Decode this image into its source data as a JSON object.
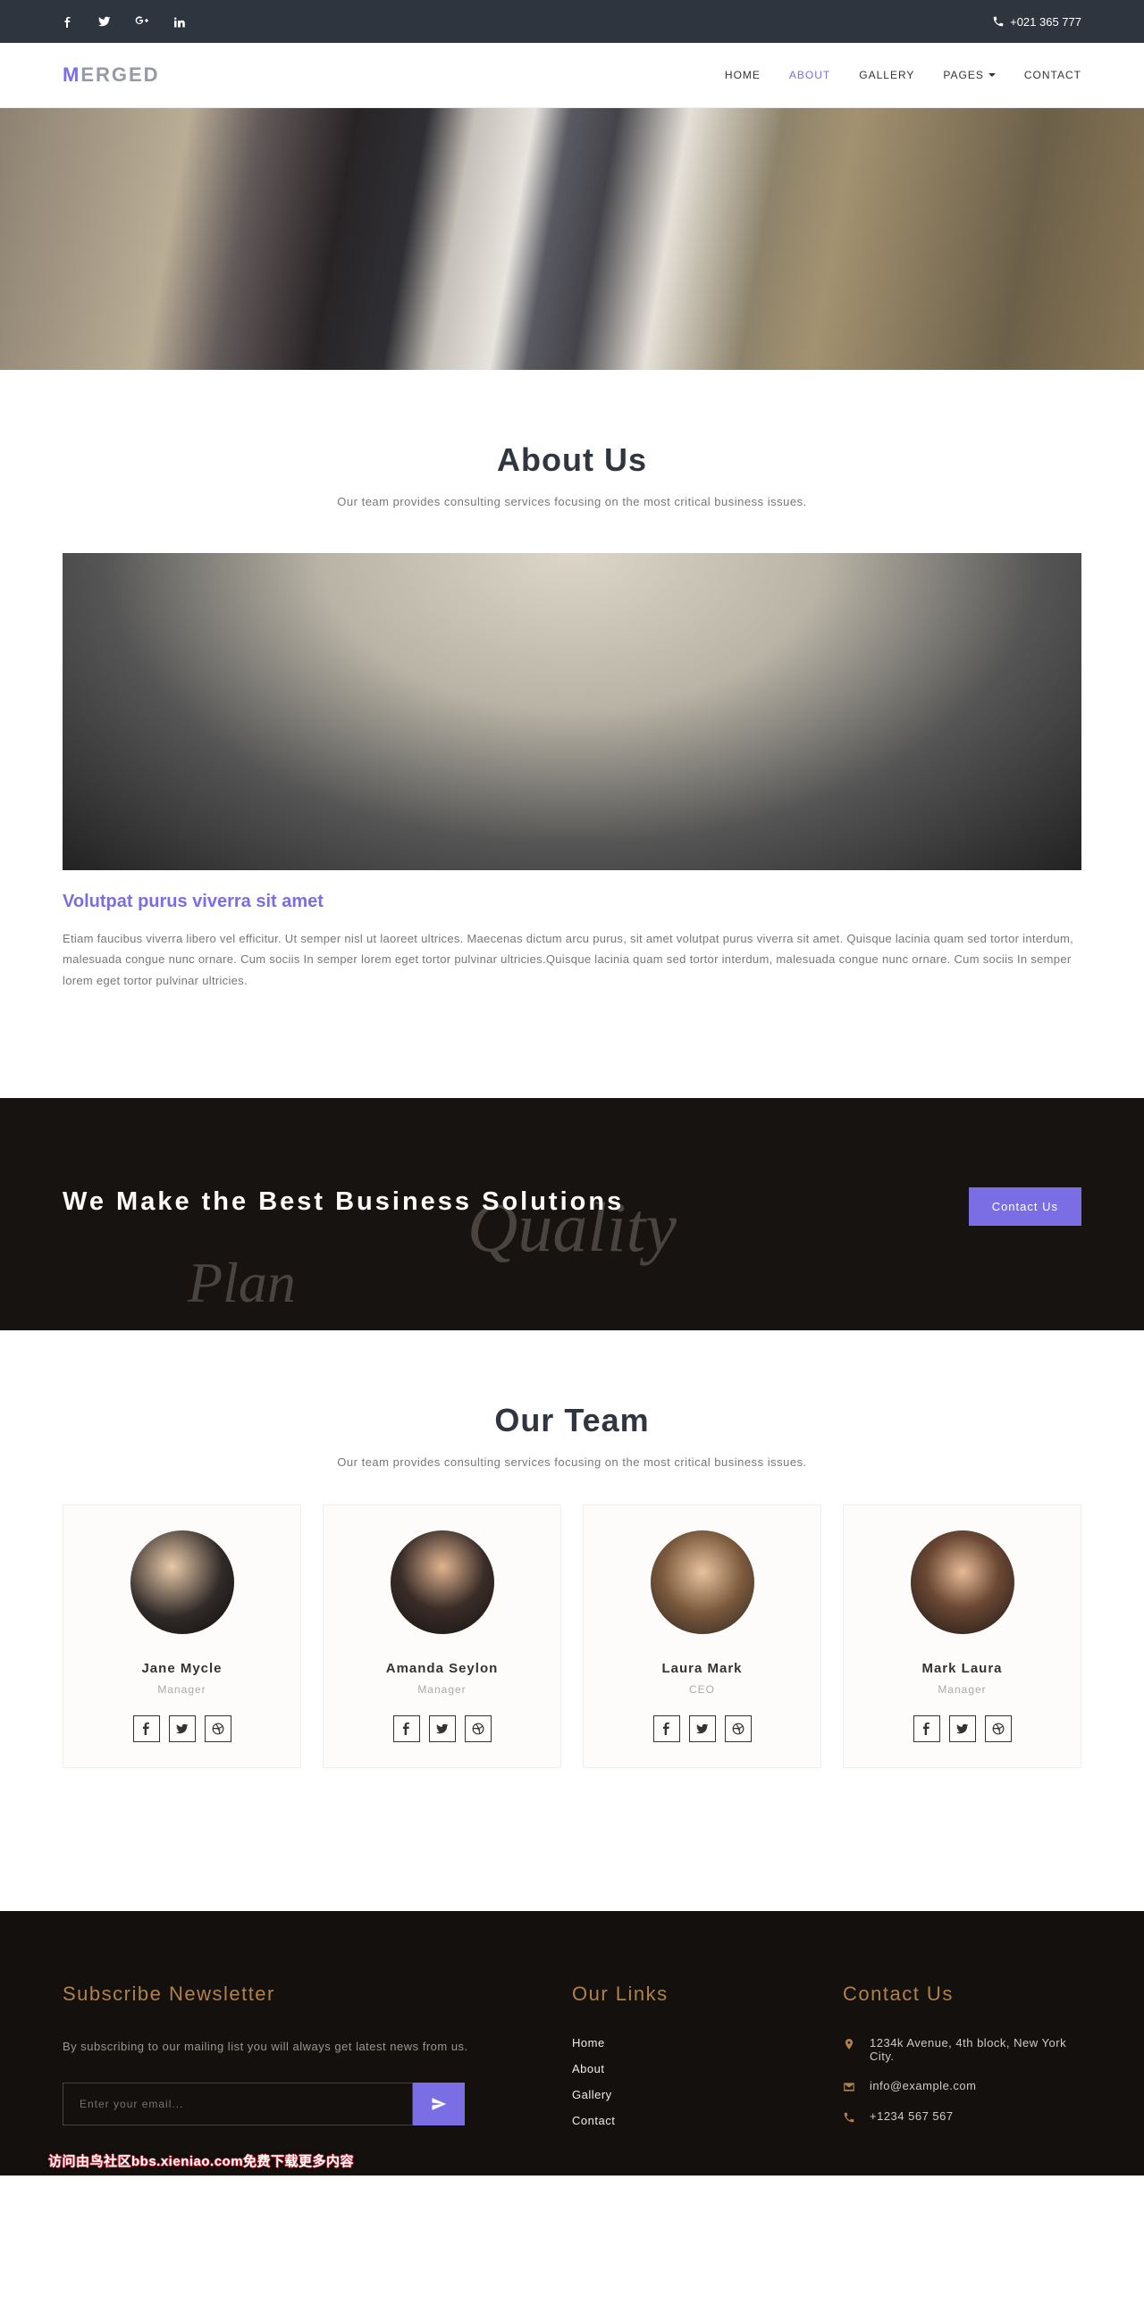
{
  "topbar": {
    "phone": "+021 365 777"
  },
  "logo": {
    "m": "M",
    "rest": "ERGED"
  },
  "nav": [
    "HOME",
    "ABOUT",
    "GALLERY",
    "PAGES",
    "CONTACT"
  ],
  "about": {
    "title": "About Us",
    "sub": "Our team provides consulting services focusing on the most critical business issues.",
    "headline": "Volutpat purus viverra sit amet",
    "body": "Etiam faucibus viverra libero vel efficitur. Ut semper nisl ut laoreet ultrices. Maecenas dictum arcu purus, sit amet volutpat purus viverra sit amet. Quisque lacinia quam sed tortor interdum, malesuada congue nunc ornare. Cum sociis In semper lorem eget tortor pulvinar ultricies.Quisque lacinia quam sed tortor interdum, malesuada congue nunc ornare. Cum sociis In semper lorem eget tortor pulvinar ultricies."
  },
  "quality": {
    "title": "We Make the Best Business Solutions",
    "btn": "Contact Us"
  },
  "team": {
    "title": "Our Team",
    "sub": "Our team provides consulting services focusing on the most critical business issues.",
    "members": [
      {
        "name": "Jane Mycle",
        "role": "Manager"
      },
      {
        "name": "Amanda Seylon",
        "role": "Manager"
      },
      {
        "name": "Laura Mark",
        "role": "CEO"
      },
      {
        "name": "Mark Laura",
        "role": "Manager"
      }
    ]
  },
  "footer": {
    "newsletter": {
      "title": "Subscribe Newsletter",
      "sub": "By subscribing to our mailing list you will always get latest news from us.",
      "placeholder": "Enter your email..."
    },
    "links": {
      "title": "Our Links",
      "items": [
        "Home",
        "About",
        "Gallery",
        "Contact"
      ]
    },
    "contact": {
      "title": "Contact Us",
      "address": "1234k Avenue, 4th block, New York City.",
      "email": "info@example.com",
      "phone": "+1234 567 567"
    }
  },
  "watermark": "访问由鸟社区bbs.xieniao.com免费下载更多内容"
}
